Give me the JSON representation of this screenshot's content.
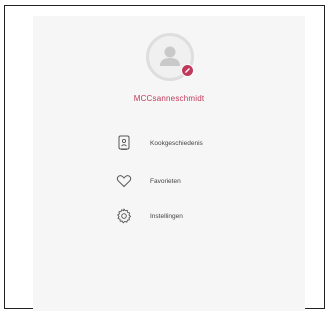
{
  "profile": {
    "username": "MCCsanneschmidt",
    "avatar_icon": "user-icon",
    "edit_icon": "pencil-icon"
  },
  "menu": {
    "items": [
      {
        "label": "Kookgeschiedenis",
        "icon": "cookbook-history-icon"
      },
      {
        "label": "Favorieten",
        "icon": "heart-icon"
      },
      {
        "label": "Instellingen",
        "icon": "gear-icon"
      }
    ]
  },
  "colors": {
    "accent": "#bf3a5a",
    "panel_background": "#f6f6f6",
    "text": "#444444"
  }
}
